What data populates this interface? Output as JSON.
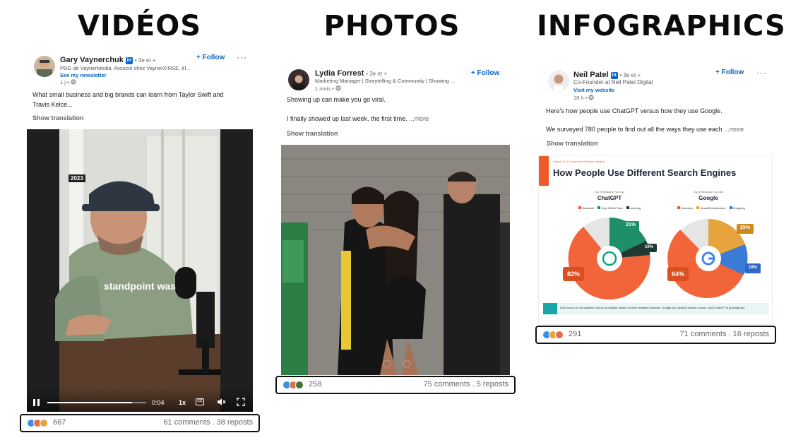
{
  "headings": {
    "videos": "VIDÉOS",
    "photos": "PHOTOS",
    "infographics": "INFOGRAPHICS"
  },
  "posts": [
    {
      "author": "Gary Vaynerchuk",
      "degree": "• 3e et +",
      "headline": "PDG de VaynerMedia, Associé chez VaynerX/RSE, él...",
      "cta": "See my newsletter",
      "age": "1 j •",
      "follow": "+ Follow",
      "more": "···",
      "text": "What small business and big brands can learn from Taylor Swift and Travis Kelce...",
      "translation": "Show translation",
      "video": {
        "year": "2023",
        "caption": "standpoint was",
        "time": "0:04",
        "speed": "1x",
        "progress": 0.86
      },
      "reactions_count": "667",
      "stats": "61 comments . 38 reposts"
    },
    {
      "author": "Lydia Forrest",
      "degree": "• 3e et +",
      "headline": "Marketing Manager | Storytelling & Community | Showing ...",
      "age": "1 mois •",
      "follow": "+ Follow",
      "text1": "Showing up can make you go viral.",
      "text2": "I finally showed up last week, the first time.",
      "see_more": "...more",
      "translation": "Show translation",
      "reactions_count": "258",
      "stats": "75 comments . 5 reposts"
    },
    {
      "author": "Neil Patel",
      "degree": "• 3e et +",
      "headline": "Co-Founder at Neil Patel Digital",
      "cta": "Visit my website",
      "age": "18 h •",
      "follow": "+ Follow",
      "more": "···",
      "text1": "Here's how people use ChatGPT versus how they use Google.",
      "text2": "We surveyed 780 people to find out all the ways they use each",
      "see_more": "...more",
      "translation": "Show translation",
      "infographic": {
        "kicker": "Search, AI & Consumer Behavior Insights",
        "title": "How People Use Different Search Engines",
        "left_sub": "Top 3 Reasons You Use",
        "left_name": "ChatGPT",
        "left_legend": [
          "Research",
          "Help With A Task",
          "Learning"
        ],
        "left_values": [
          "82%",
          "21%",
          "10%"
        ],
        "right_sub": "Top 3 Reasons You Use",
        "right_name": "Google",
        "right_legend": [
          "Research",
          "News/Entertainment",
          "Shopping"
        ],
        "right_values": [
          "64%",
          "25%",
          "18%"
        ],
        "footer": "Don't focus on one platform, focus on multiple. Based on their released numbers, Google isn't dying in search volume, and ChatGPT is growing fast."
      },
      "reactions_count": "291",
      "stats": "71 comments . 16 reposts"
    }
  ],
  "colors": {
    "linkedin_blue": "#0a66c2",
    "like_blue": "#378fe9",
    "celebrate_green": "#44712e",
    "love_red": "#df704d",
    "orange": "#f05a28"
  }
}
